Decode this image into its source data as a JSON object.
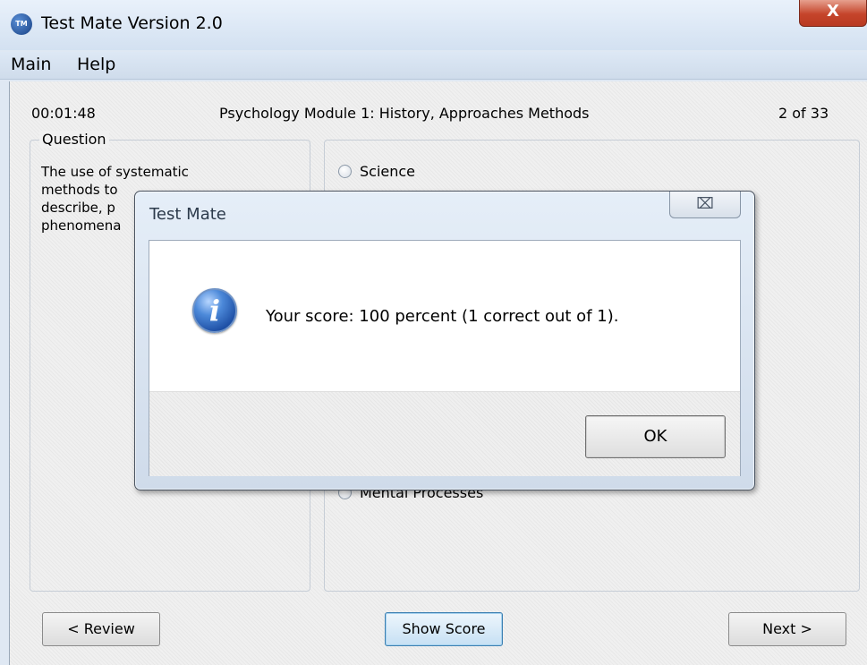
{
  "window": {
    "title": "Test Mate Version 2.0",
    "icon_text": "TM",
    "close_glyph": "X"
  },
  "menu": [
    "Main",
    "Help"
  ],
  "header": {
    "timer": "00:01:48",
    "module": "Psychology Module 1: History, Approaches  Methods",
    "progress": "2 of 33"
  },
  "question": {
    "legend": "Question",
    "text_lines": [
      "The use of systematic",
      "methods to",
      "describe, p",
      "phenomena"
    ]
  },
  "answers": [
    {
      "label": "Science",
      "selected": false
    },
    {
      "label": "Mental Processes",
      "selected": false
    }
  ],
  "buttons": {
    "review": "< Review",
    "show_score": "Show Score",
    "next": "Next >"
  },
  "dialog": {
    "title": "Test Mate",
    "close_glyph": "⌧",
    "message": "Your score: 100 percent (1 correct out of 1).",
    "icon_glyph": "i",
    "ok": "OK"
  }
}
